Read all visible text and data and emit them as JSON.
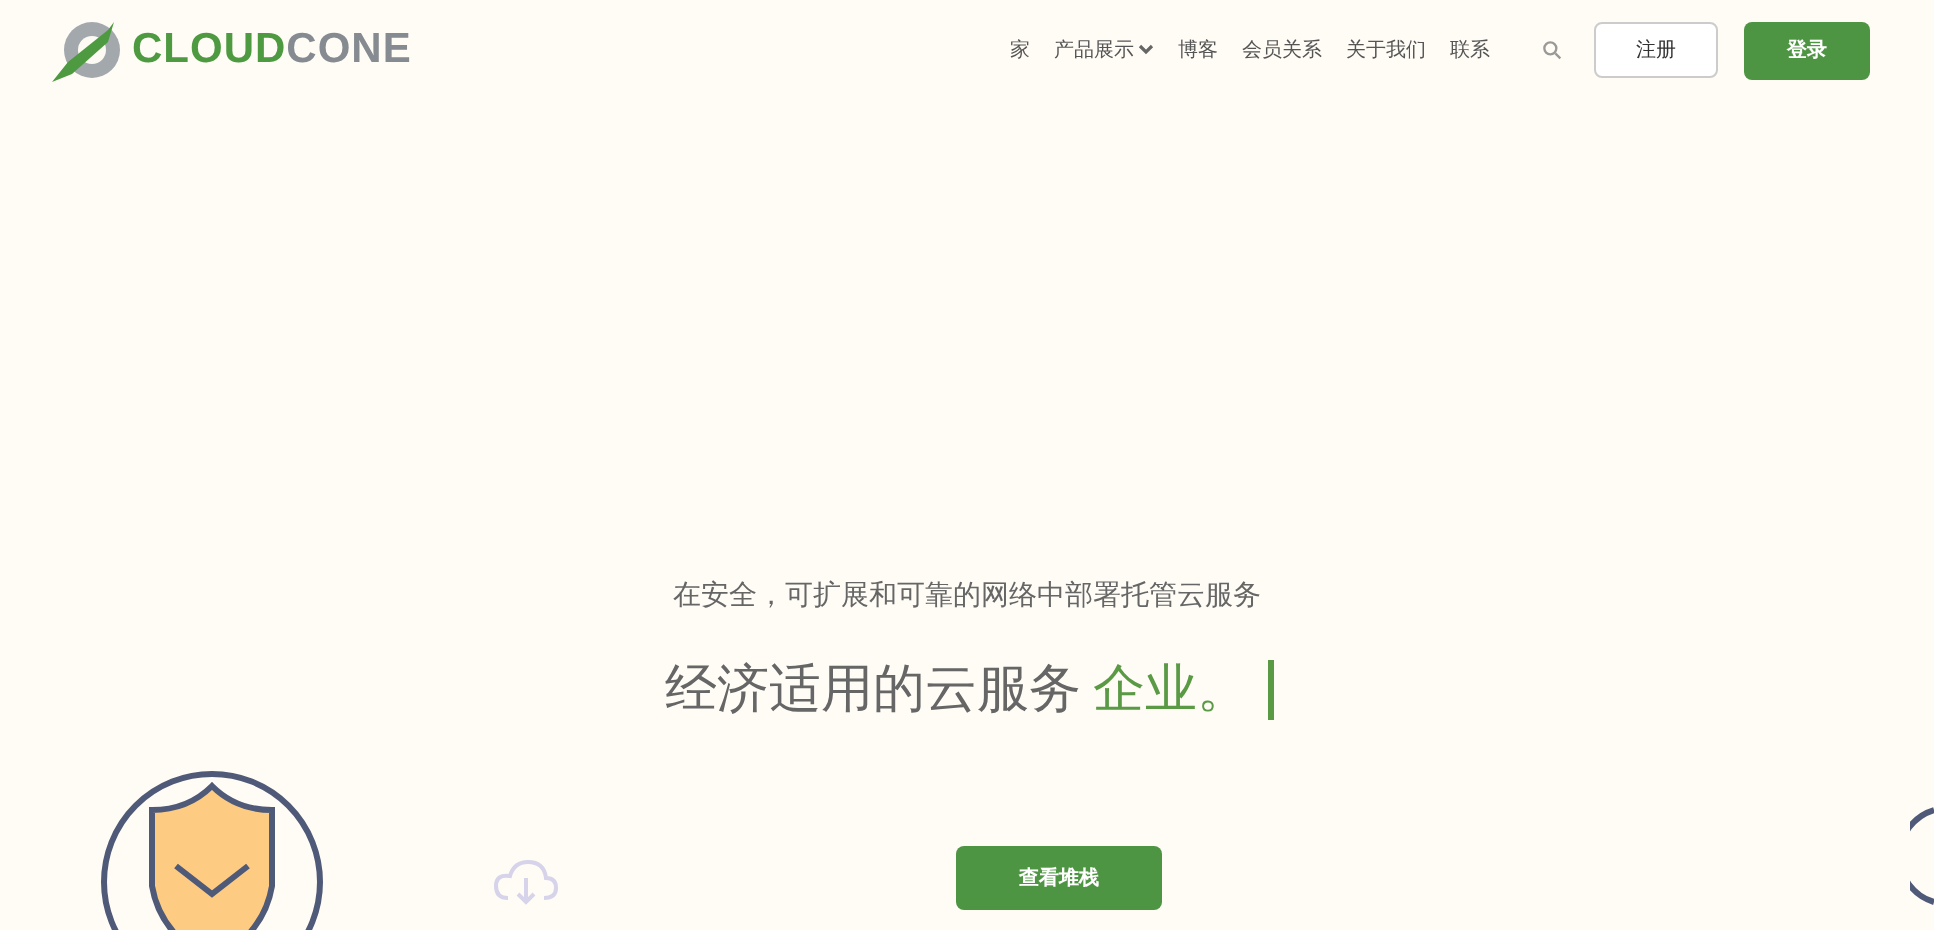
{
  "logo": {
    "parts": [
      "CLOUD",
      "CONE"
    ]
  },
  "nav": [
    {
      "label": "家",
      "dropdown": false
    },
    {
      "label": "产品展示",
      "dropdown": true
    },
    {
      "label": "博客",
      "dropdown": false
    },
    {
      "label": "会员关系",
      "dropdown": false
    },
    {
      "label": "关于我们",
      "dropdown": false
    },
    {
      "label": "联系",
      "dropdown": false
    }
  ],
  "register_button": "注册",
  "login_button": "登录",
  "hero": {
    "subtitle": "在安全，可扩展和可靠的网络中部署托管云服务",
    "headline": "经济适用的云服务",
    "headline_accent": "企业。",
    "cta_button": "查看堆栈"
  }
}
